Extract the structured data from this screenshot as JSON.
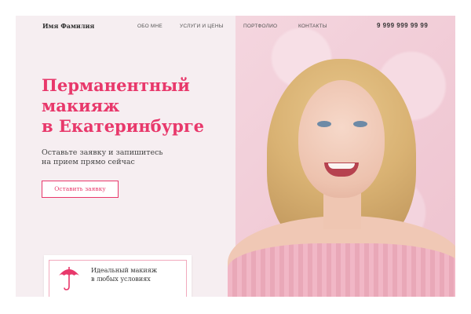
{
  "header": {
    "logo": "Имя Фамилия",
    "nav": [
      "ОБО МНЕ",
      "УСЛУГИ И ЦЕНЫ",
      "ПОРТФОЛИО",
      "КОНТАКТЫ"
    ],
    "phone": "9 999 999 99 99"
  },
  "hero": {
    "title_lines": [
      "Перманентный",
      "макияж",
      "в Екатеринбурге"
    ],
    "subtitle_lines": [
      "Оставьте заявку и запишитесь",
      "на прием прямо сейчас"
    ],
    "cta_label": "Оставить заявку"
  },
  "feature_card": {
    "icon": "umbrella-icon",
    "text_lines": [
      "Идеальный макияж",
      "в любых условиях"
    ]
  },
  "colors": {
    "accent": "#e8386b",
    "background": "#f6eef1",
    "photo_bg": "#f1cbd6"
  }
}
